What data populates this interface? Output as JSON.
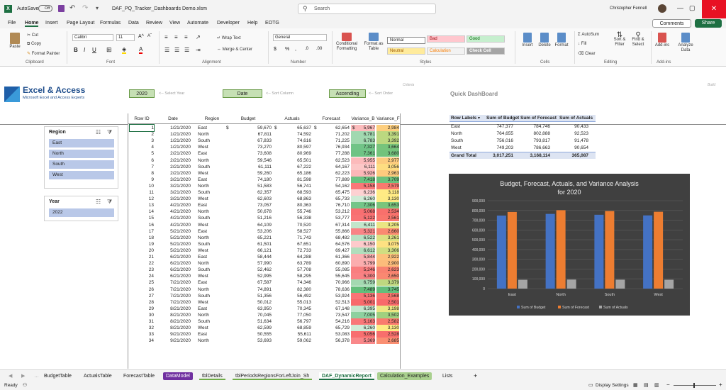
{
  "titlebar": {
    "autosave_label": "AutoSave",
    "autosave_state": "Off",
    "filename": "DAF_PQ_Tracker_Dashboards Demo.xlsm",
    "search_placeholder": "Search",
    "user_name": "Christopher Fennell"
  },
  "menu": {
    "items": [
      "File",
      "Home",
      "Insert",
      "Page Layout",
      "Formulas",
      "Data",
      "Review",
      "View",
      "Automate",
      "Developer",
      "Help",
      "EOTG"
    ],
    "active": "Home",
    "comments": "Comments",
    "share": "Share"
  },
  "ribbon": {
    "clipboard": {
      "paste": "Paste",
      "cut": "Cut",
      "copy": "Copy",
      "format_painter": "Format Painter",
      "label": "Clipboard"
    },
    "font": {
      "name": "Calibri",
      "size": "11",
      "label": "Font"
    },
    "alignment": {
      "wrap": "Wrap Text",
      "merge": "Merge & Center",
      "label": "Alignment"
    },
    "number": {
      "format": "General",
      "label": "Number"
    },
    "styles": {
      "conditional": "Conditional Formatting",
      "format_as_table": "Format as Table",
      "normal": "Normal",
      "bad": "Bad",
      "good": "Good",
      "neutral": "Neutral",
      "calculation": "Calculation",
      "check_cell": "Check Cell",
      "label": "Styles"
    },
    "cells": {
      "insert": "Insert",
      "delete": "Delete",
      "format": "Format",
      "label": "Cells"
    },
    "editing": {
      "autosum": "AutoSum",
      "fill": "Fill",
      "clear": "Clear",
      "sort": "Sort & Filter",
      "find": "Find & Select",
      "label": "Editing"
    },
    "addins": {
      "addins": "Add-ins",
      "analyze": "Analyze Data",
      "label": "Add-ins"
    }
  },
  "sheet": {
    "logo_text": "Excel & Access",
    "logo_sub": "Microsoft Excel and Access Experts",
    "year_value": "2020",
    "year_hint": "<-- Select Year",
    "sort_column_value": "Date",
    "sort_column_hint": "<-- Sort Column",
    "sort_order_value": "Ascending",
    "sort_order_hint": "<-- Sort Order",
    "criteria_label": "Criteria",
    "build_label": "Build",
    "dashboard_title": "Quick DashBoard",
    "headers": [
      "Row ID",
      "Date",
      "Region",
      "Budget",
      "Actuals",
      "Forecast",
      "Variance_B",
      "Variance_F"
    ],
    "rows": [
      [
        "1",
        "1/21/2020",
        "East",
        "59,670",
        "65,637",
        "62,654",
        "5,967",
        "2,984"
      ],
      [
        "2",
        "1/21/2020",
        "North",
        "67,811",
        "74,592",
        "71,202",
        "6,781",
        "3,391"
      ],
      [
        "3",
        "1/21/2020",
        "South",
        "67,833",
        "74,616",
        "71,225",
        "6,783",
        "3,392"
      ],
      [
        "4",
        "1/21/2020",
        "West",
        "73,270",
        "80,597",
        "76,934",
        "7,327",
        "3,664"
      ],
      [
        "5",
        "2/21/2020",
        "East",
        "73,608",
        "80,969",
        "77,288",
        "7,361",
        "3,680"
      ],
      [
        "6",
        "2/21/2020",
        "North",
        "59,546",
        "65,501",
        "62,523",
        "5,955",
        "2,977"
      ],
      [
        "7",
        "2/21/2020",
        "South",
        "61,111",
        "67,222",
        "64,167",
        "6,111",
        "3,056"
      ],
      [
        "8",
        "2/21/2020",
        "West",
        "59,260",
        "65,186",
        "62,223",
        "5,926",
        "2,963"
      ],
      [
        "9",
        "3/21/2020",
        "East",
        "74,180",
        "81,598",
        "77,889",
        "7,418",
        "3,709"
      ],
      [
        "10",
        "3/21/2020",
        "North",
        "51,583",
        "56,741",
        "54,162",
        "5,158",
        "2,579"
      ],
      [
        "11",
        "3/21/2020",
        "South",
        "62,357",
        "68,593",
        "65,475",
        "6,236",
        "3,118"
      ],
      [
        "12",
        "3/21/2020",
        "West",
        "62,603",
        "68,863",
        "65,733",
        "6,260",
        "3,130"
      ],
      [
        "13",
        "4/21/2020",
        "East",
        "73,057",
        "80,363",
        "76,710",
        "7,306",
        "3,653"
      ],
      [
        "14",
        "4/21/2020",
        "North",
        "50,678",
        "55,746",
        "53,212",
        "5,068",
        "2,534"
      ],
      [
        "15",
        "4/21/2020",
        "South",
        "51,216",
        "56,338",
        "53,777",
        "5,122",
        "2,561"
      ],
      [
        "16",
        "4/21/2020",
        "West",
        "64,109",
        "70,520",
        "67,314",
        "6,411",
        "3,205"
      ],
      [
        "17",
        "5/21/2020",
        "East",
        "53,206",
        "58,527",
        "55,866",
        "5,321",
        "2,660"
      ],
      [
        "18",
        "5/21/2020",
        "North",
        "65,221",
        "71,743",
        "68,482",
        "6,522",
        "3,261"
      ],
      [
        "19",
        "5/21/2020",
        "South",
        "61,501",
        "67,651",
        "64,576",
        "6,150",
        "3,075"
      ],
      [
        "20",
        "5/21/2020",
        "West",
        "66,121",
        "72,733",
        "69,427",
        "6,612",
        "3,306"
      ],
      [
        "21",
        "6/21/2020",
        "East",
        "58,444",
        "64,288",
        "61,366",
        "5,844",
        "2,922"
      ],
      [
        "22",
        "6/21/2020",
        "North",
        "57,990",
        "63,789",
        "60,890",
        "5,799",
        "2,900"
      ],
      [
        "23",
        "6/21/2020",
        "South",
        "52,462",
        "57,708",
        "55,085",
        "5,246",
        "2,623"
      ],
      [
        "24",
        "6/21/2020",
        "West",
        "52,995",
        "58,295",
        "55,645",
        "5,300",
        "2,650"
      ],
      [
        "25",
        "7/21/2020",
        "East",
        "67,587",
        "74,346",
        "70,966",
        "6,759",
        "3,379"
      ],
      [
        "26",
        "7/21/2020",
        "North",
        "74,891",
        "82,380",
        "78,636",
        "7,489",
        "3,745"
      ],
      [
        "27",
        "7/21/2020",
        "South",
        "51,356",
        "56,492",
        "53,924",
        "5,136",
        "2,568"
      ],
      [
        "28",
        "7/21/2020",
        "West",
        "50,012",
        "55,013",
        "52,513",
        "5,001",
        "2,501"
      ],
      [
        "29",
        "8/21/2020",
        "East",
        "63,950",
        "70,345",
        "67,148",
        "6,395",
        "3,198"
      ],
      [
        "30",
        "8/21/2020",
        "North",
        "70,045",
        "77,050",
        "73,547",
        "7,005",
        "3,502"
      ],
      [
        "31",
        "8/21/2020",
        "South",
        "51,634",
        "56,797",
        "54,216",
        "5,163",
        "2,582"
      ],
      [
        "32",
        "8/21/2020",
        "West",
        "62,599",
        "68,859",
        "65,729",
        "6,260",
        "3,130"
      ],
      [
        "33",
        "9/21/2020",
        "East",
        "50,555",
        "55,611",
        "53,083",
        "5,056",
        "2,528"
      ],
      [
        "34",
        "9/21/2020",
        "North",
        "53,693",
        "59,062",
        "56,378",
        "5,369",
        "2,685"
      ]
    ],
    "slicer_region": {
      "title": "Region",
      "items": [
        "East",
        "North",
        "South",
        "West"
      ]
    },
    "slicer_year": {
      "title": "Year",
      "items": [
        "2022"
      ]
    },
    "pivot": {
      "headers": [
        "Row Labels",
        "Sum of Budget",
        "Sum of Forecast",
        "Sum of Actuals"
      ],
      "rows": [
        [
          "East",
          "747,377",
          "784,746",
          "90,433"
        ],
        [
          "North",
          "764,655",
          "802,888",
          "92,523"
        ],
        [
          "South",
          "756,016",
          "793,817",
          "91,478"
        ],
        [
          "West",
          "749,203",
          "786,663",
          "90,654"
        ]
      ],
      "total": [
        "Grand Total",
        "3,017,251",
        "3,168,114",
        "365,087"
      ]
    }
  },
  "chart_data": {
    "type": "bar",
    "title": "Budget, Forecast, Actuals, and Variance Analysis for 2020",
    "categories": [
      "East",
      "North",
      "South",
      "West"
    ],
    "series": [
      {
        "name": "Sum of Budget",
        "values": [
          747377,
          764655,
          756016,
          749203
        ],
        "color": "#4472c4"
      },
      {
        "name": "Sum of Forecast",
        "values": [
          784746,
          802888,
          793817,
          786663
        ],
        "color": "#ed7d31"
      },
      {
        "name": "Sum of Actuals",
        "values": [
          90433,
          92523,
          91478,
          90654
        ],
        "color": "#a5a5a5"
      }
    ],
    "ylim": [
      0,
      900000
    ],
    "yticks": [
      "900,000",
      "800,000",
      "700,000",
      "600,000",
      "500,000",
      "400,000",
      "300,000",
      "200,000",
      "100,000",
      "0"
    ],
    "legend": "bottom",
    "grid": true
  },
  "tabs": {
    "items": [
      "BudgetTable",
      "ActualsTable",
      "ForecastTable",
      "DataModel",
      "tblDetails",
      "tblPeriodsRegionsForLeftJoin_Sh",
      "DAF_DynamicReport",
      "Calculation_Examples",
      "Lists"
    ],
    "active": "DAF_DynamicReport"
  },
  "status": {
    "ready": "Ready",
    "display_settings": "Display Settings"
  }
}
